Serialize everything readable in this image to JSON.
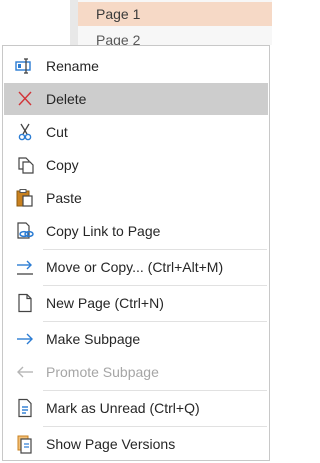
{
  "pages": [
    {
      "label": "Page 1",
      "selected": true
    },
    {
      "label": "Page 2",
      "selected": false
    }
  ],
  "menu": {
    "rename": "Rename",
    "delete": "Delete",
    "cut": "Cut",
    "copy": "Copy",
    "paste": "Paste",
    "copy_link": "Copy Link to Page",
    "move_copy": "Move or Copy...  (Ctrl+Alt+M)",
    "new_page": "New Page  (Ctrl+N)",
    "make_subpage": "Make Subpage",
    "promote_subpage": "Promote Subpage",
    "mark_unread": "Mark as Unread  (Ctrl+Q)",
    "show_versions": "Show Page Versions"
  },
  "colors": {
    "accent_blue": "#2b7cd3",
    "delete_red": "#d13438",
    "selected_page": "#f6d9c6",
    "hover": "#cdcdcd"
  }
}
